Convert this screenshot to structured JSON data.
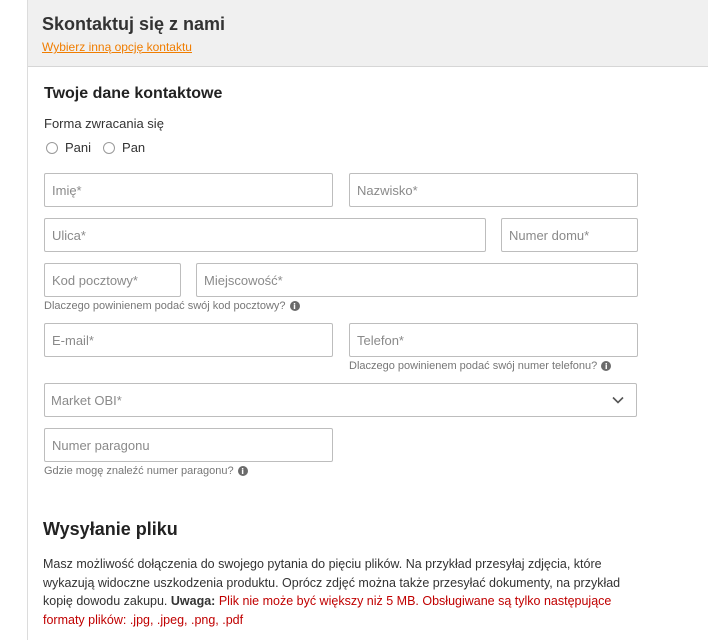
{
  "header": {
    "title": "Skontaktuj się z nami",
    "link": "Wybierz inną opcję kontaktu"
  },
  "contact": {
    "title": "Twoje dane kontaktowe",
    "salutation_label": "Forma zwracania się",
    "salutation_options": [
      "Pani",
      "Pan"
    ],
    "first_name_placeholder": "Imię*",
    "last_name_placeholder": "Nazwisko*",
    "street_placeholder": "Ulica*",
    "house_number_placeholder": "Numer domu*",
    "postal_code_placeholder": "Kod pocztowy*",
    "city_placeholder": "Miejscowość*",
    "postal_code_hint": "Dlaczego powinienem podać swój kod pocztowy?",
    "email_placeholder": "E-mail*",
    "phone_placeholder": "Telefon*",
    "phone_hint": "Dlaczego powinienem podać swój numer telefonu?",
    "market_select_value": "Market OBI*",
    "receipt_placeholder": "Numer paragonu",
    "receipt_hint": "Gdzie mogę znaleźć numer paragonu?",
    "info_glyph": "i"
  },
  "upload": {
    "title": "Wysyłanie pliku",
    "desc": "Masz możliwość dołączenia do swojego pytania do pięciu plików. Na przykład przesyłaj zdjęcia, które wykazują widoczne uszkodzenia produktu. Oprócz zdjęć można także przesyłać dokumenty, na przykład kopię dowodu zakupu.",
    "warning_label": "Uwaga:",
    "warning_text": "Plik nie może być większy niż 5 MB. Obsługiwane są tylko następujące formaty plików: .jpg, .jpeg, .png, .pdf"
  },
  "colors": {
    "accent_link": "#f07d00",
    "warning": "#c00000",
    "header_bg": "#f0f0f0"
  }
}
